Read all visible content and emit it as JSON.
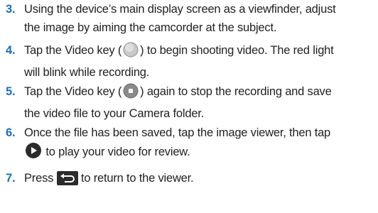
{
  "colors": {
    "step_number": "#1f6fb2",
    "icon_dark": "#2b2b2b",
    "icon_gray": "#c9c9c9"
  },
  "steps": [
    {
      "number": "3.",
      "line1": "Using the device’s main display screen as a viewfinder, adjust",
      "line2": "the image by aiming the camcorder at the subject."
    },
    {
      "number": "4.",
      "line1_a": "Tap the Video key (",
      "line1_icon": "video-record-key-icon",
      "line1_b": ") to begin shooting video. The red light",
      "line2": "will blink while recording."
    },
    {
      "number": "5.",
      "line1_a": "Tap the Video key (",
      "line1_icon": "video-stop-key-icon",
      "line1_b": ") again to stop the recording and save",
      "line2": "the video file to your Camera folder."
    },
    {
      "number": "6.",
      "line1": "Once the file has been saved, tap the image viewer, then tap",
      "line2_icon": "play-icon",
      "line2": "to play your video for review."
    },
    {
      "number": "7.",
      "line1_a": "Press",
      "line1_icon": "back-key-icon",
      "line1_b": "to return to the viewer."
    }
  ]
}
